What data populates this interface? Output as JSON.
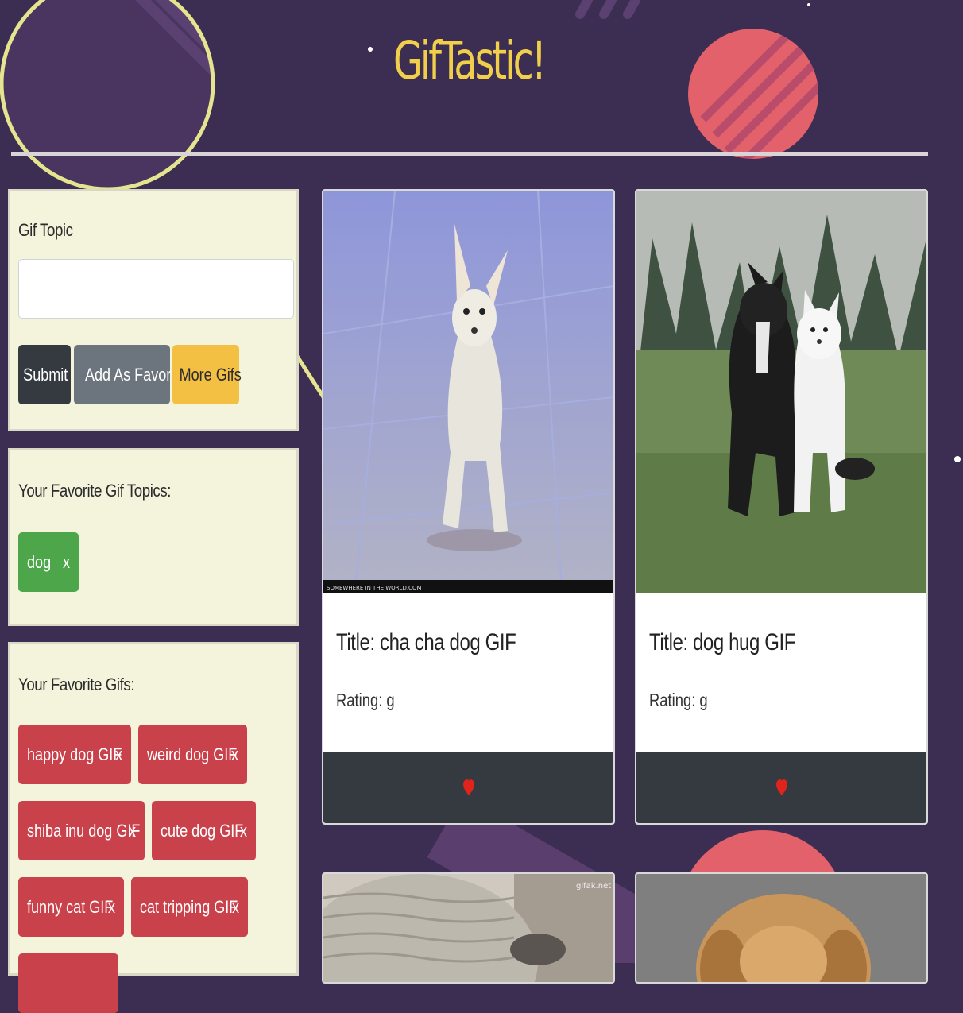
{
  "header": {
    "title": "GifTastic!"
  },
  "form_panel": {
    "label": "Gif Topic",
    "input_value": "",
    "buttons": {
      "submit": "Submit",
      "add_favorite": "Add As Favorite",
      "more": "More Gifs"
    }
  },
  "fav_topics": {
    "label": "Your Favorite Gif Topics:",
    "items": [
      {
        "label": "dog",
        "remove": "x"
      }
    ]
  },
  "fav_gifs": {
    "label": "Your Favorite Gifs:",
    "items": [
      {
        "label": "happy dog GIF",
        "remove": "x"
      },
      {
        "label": "weird dog GIF",
        "remove": "x"
      },
      {
        "label": "shiba inu dog GIF",
        "remove": "x"
      },
      {
        "label": "cute dog GIF",
        "remove": "x"
      },
      {
        "label": "funny cat GIF",
        "remove": "x"
      },
      {
        "label": "cat tripping GIF",
        "remove": "x"
      }
    ]
  },
  "gifs": [
    {
      "title": "Title: cha cha dog GIF",
      "rating": "Rating: g",
      "watermark": "SOMEWHERE IN THE WORLD.COM"
    },
    {
      "title": "Title: dog hug GIF",
      "rating": "Rating: g"
    },
    {
      "watermark": "gifak.net"
    },
    {}
  ],
  "colors": {
    "background": "#3b2e52",
    "title": "#f2cf4a",
    "panel": "#f4f3dc",
    "submit": "#343a40",
    "secondary": "#6c757d",
    "warning": "#f3c043",
    "topic_chip": "#4ea64a",
    "gif_chip": "#c9424b",
    "heart": "#e0241b"
  },
  "icons": {
    "favorite": "heart-icon"
  }
}
